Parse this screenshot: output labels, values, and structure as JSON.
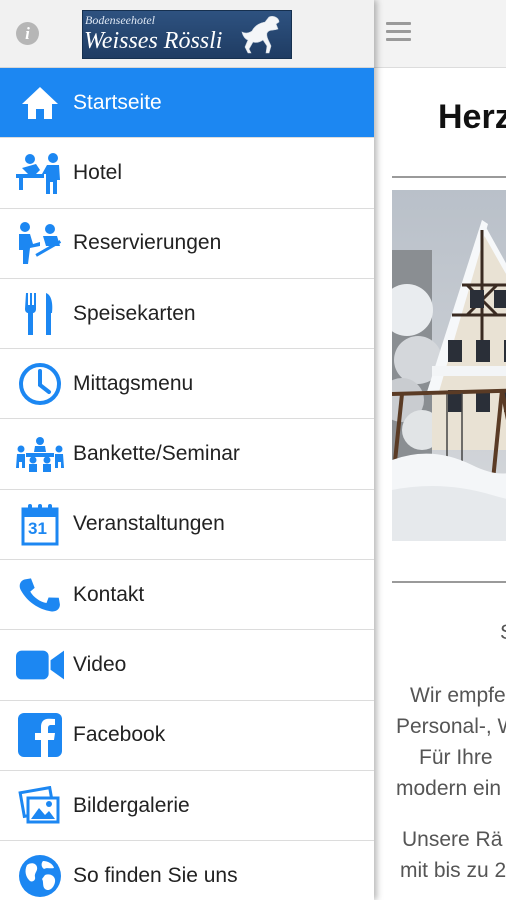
{
  "drawer": {
    "logo": {
      "small_text": "Bodenseehotel",
      "big_text": "Weisses Rössli"
    },
    "menu": [
      {
        "label": "Startseite",
        "icon": "home-icon",
        "active": true
      },
      {
        "label": "Hotel",
        "icon": "reception-icon"
      },
      {
        "label": "Reservierungen",
        "icon": "reservation-icon"
      },
      {
        "label": "Speisekarten",
        "icon": "fork-knife-icon"
      },
      {
        "label": "Mittagsmenu",
        "icon": "clock-icon"
      },
      {
        "label": "Bankette/Seminar",
        "icon": "banquet-icon"
      },
      {
        "label": "Veranstaltungen",
        "icon": "calendar-icon",
        "calendar_day": "31"
      },
      {
        "label": "Kontakt",
        "icon": "phone-icon"
      },
      {
        "label": "Video",
        "icon": "video-camera-icon"
      },
      {
        "label": "Facebook",
        "icon": "facebook-icon"
      },
      {
        "label": "Bildergalerie",
        "icon": "gallery-icon"
      },
      {
        "label": "So finden Sie uns",
        "icon": "globe-icon"
      }
    ]
  },
  "main": {
    "heading": "Herz",
    "paragraph_1": [
      "S",
      "",
      "Wir empfe",
      "Personal-, W",
      "Für Ihre",
      "modern ein"
    ],
    "paragraph_2": [
      "Unsere Rä",
      "mit bis zu 2"
    ]
  },
  "colors": {
    "accent": "#1c87f2",
    "icon_blue": "#1c87f2",
    "text": "#222222"
  }
}
